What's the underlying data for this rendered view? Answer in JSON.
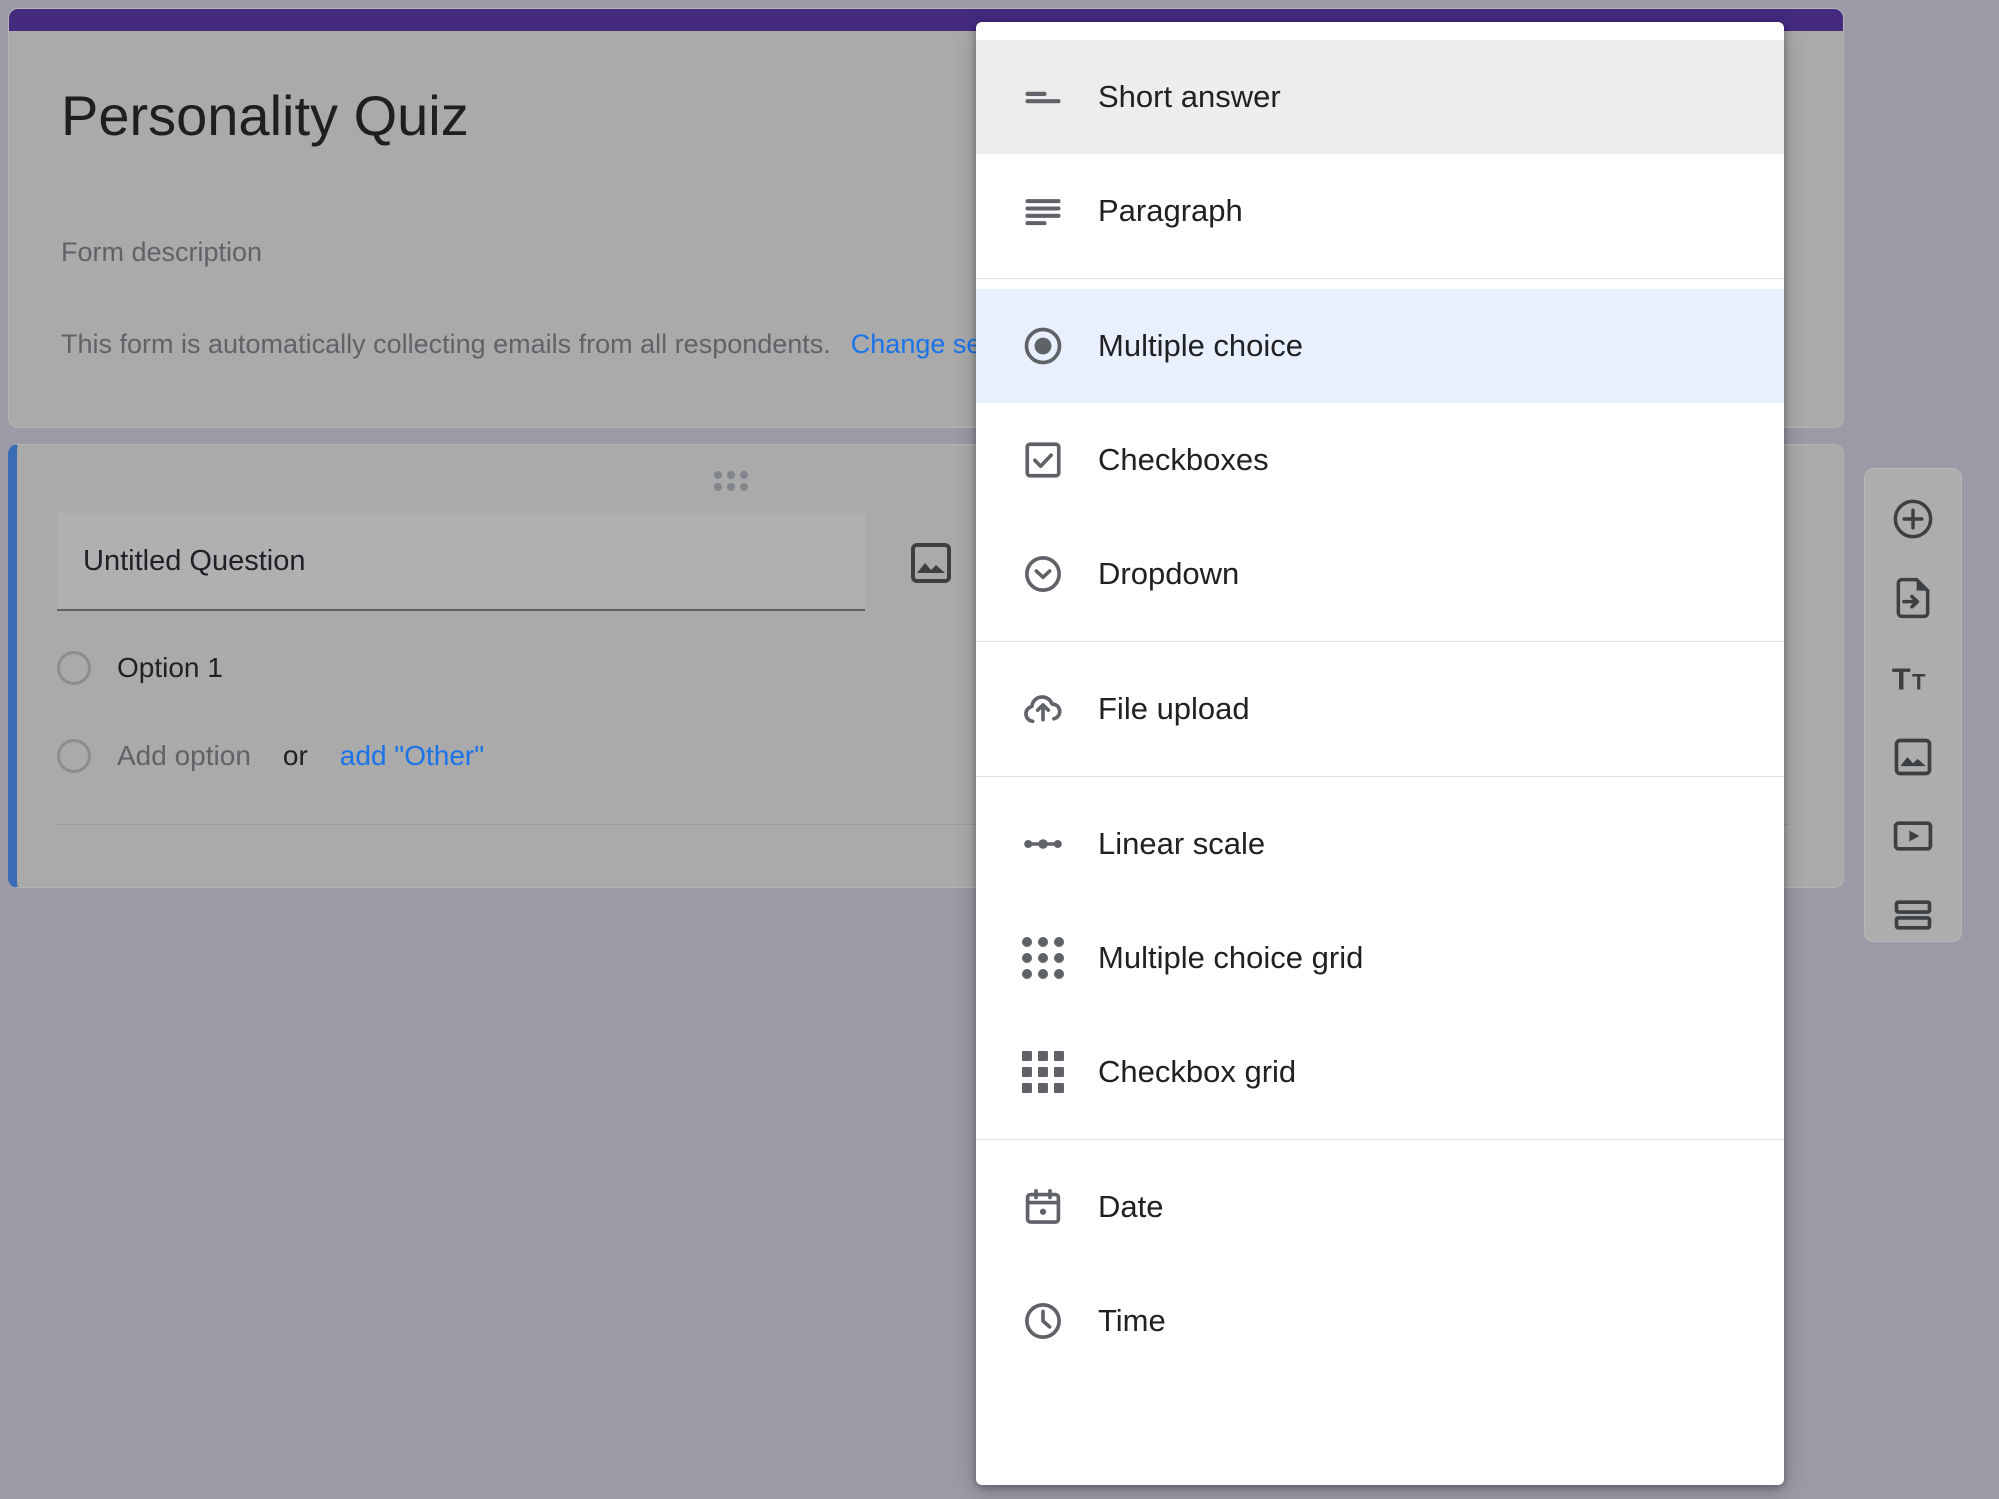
{
  "theme": {
    "header_stripe_color": "#452A80",
    "selected_card_accent": "#3a6cb5",
    "link_color": "#1a73e8",
    "menu_hover_bg": "#ededed",
    "menu_selected_bg": "#e8f0fe"
  },
  "form": {
    "title": "Personality Quiz",
    "description_placeholder": "Form description",
    "email_notice": "This form is automatically collecting emails from all respondents.",
    "email_notice_link": "Change set"
  },
  "question": {
    "title_value": "Untitled Question",
    "options": [
      {
        "label": "Option 1",
        "muted": false
      }
    ],
    "add_option_label": "Add option",
    "or_label": "or",
    "add_other_label": "add \"Other\"",
    "drag_handle_icon": "drag-handle-icon",
    "image_icon": "insert-image-icon",
    "duplicate_icon": "duplicate-icon"
  },
  "side_toolbar": {
    "items": [
      {
        "name": "add-question-button",
        "icon": "plus-circle-icon"
      },
      {
        "name": "import-questions-button",
        "icon": "import-file-icon"
      },
      {
        "name": "add-title-description-button",
        "icon": "title-text-icon"
      },
      {
        "name": "add-image-button",
        "icon": "image-icon"
      },
      {
        "name": "add-video-button",
        "icon": "video-icon"
      },
      {
        "name": "add-section-button",
        "icon": "section-split-icon"
      }
    ]
  },
  "type_menu": {
    "groups": [
      {
        "items": [
          {
            "label": "Short answer",
            "icon": "short-answer-icon",
            "state": "hovered"
          },
          {
            "label": "Paragraph",
            "icon": "paragraph-icon",
            "state": "normal"
          }
        ]
      },
      {
        "items": [
          {
            "label": "Multiple choice",
            "icon": "radio-button-icon",
            "state": "selected"
          },
          {
            "label": "Checkboxes",
            "icon": "checkbox-icon",
            "state": "normal"
          },
          {
            "label": "Dropdown",
            "icon": "dropdown-circle-icon",
            "state": "normal"
          }
        ]
      },
      {
        "items": [
          {
            "label": "File upload",
            "icon": "cloud-upload-icon",
            "state": "normal"
          }
        ]
      },
      {
        "items": [
          {
            "label": "Linear scale",
            "icon": "linear-scale-icon",
            "state": "normal"
          },
          {
            "label": "Multiple choice grid",
            "icon": "dot-grid-icon",
            "state": "normal"
          },
          {
            "label": "Checkbox grid",
            "icon": "square-grid-icon",
            "state": "normal"
          }
        ]
      },
      {
        "items": [
          {
            "label": "Date",
            "icon": "calendar-icon",
            "state": "normal"
          },
          {
            "label": "Time",
            "icon": "clock-icon",
            "state": "normal"
          }
        ]
      }
    ]
  }
}
